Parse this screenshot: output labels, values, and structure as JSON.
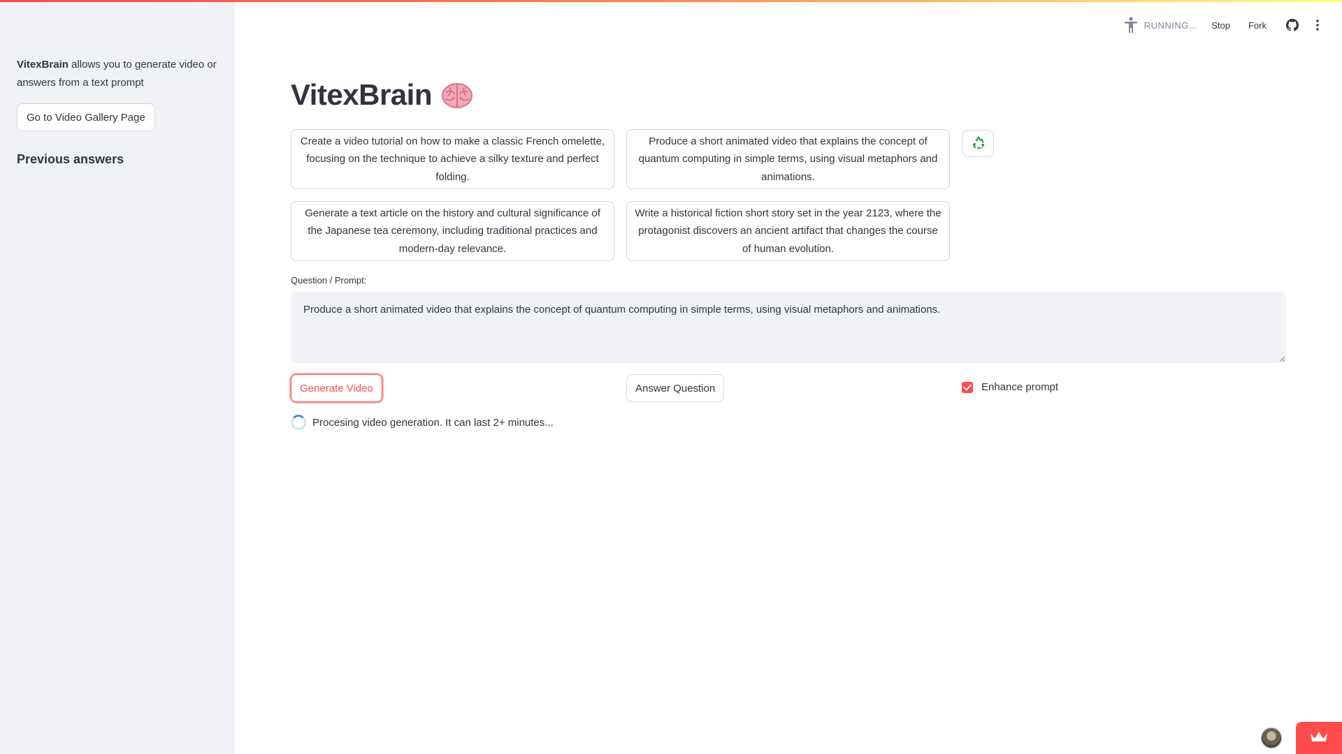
{
  "sidebar": {
    "app_name": "VitexBrain",
    "description_rest": " allows you to generate video or answers from a text prompt",
    "gallery_button": "Go to Video Gallery Page",
    "previous_answers": "Previous answers"
  },
  "header": {
    "status": "RUNNING...",
    "stop": "Stop",
    "fork": "Fork"
  },
  "main": {
    "title": "VitexBrain",
    "suggestions": [
      "Create a video tutorial on how to make a classic French omelette, focusing on the technique to achieve a silky texture and perfect folding.",
      "Produce a short animated video that explains the concept of quantum computing in simple terms, using visual metaphors and animations.",
      "Generate a text article on the history and cultural significance of the Japanese tea ceremony, including traditional practices and modern-day relevance.",
      "Write a historical fiction short story set in the year 2123, where the protagonist discovers an ancient artifact that changes the course of human evolution."
    ],
    "prompt_label": "Question / Prompt:",
    "prompt_value": "Produce a short animated video that explains the concept of quantum computing in simple terms, using visual metaphors and animations.",
    "generate_button": "Generate Video",
    "answer_button": "Answer Question",
    "enhance_label": "Enhance prompt",
    "enhance_checked": true,
    "processing_text": "Procesing video generation. It can last 2+ minutes..."
  },
  "icons": {
    "status": "accessibility-figure-icon",
    "github": "github-icon",
    "menu": "kebab-menu-icon",
    "brain": "brain-emoji-icon",
    "refresh": "recycle-icon",
    "checkbox": "check-icon",
    "spinner": "spinner-icon",
    "badge": "crown-icon"
  },
  "colors": {
    "accent": "#ff4b4b",
    "sidebar_bg": "#f0f2f6",
    "text": "#31333f",
    "muted": "#808495",
    "recycle": "#1aa03a"
  }
}
